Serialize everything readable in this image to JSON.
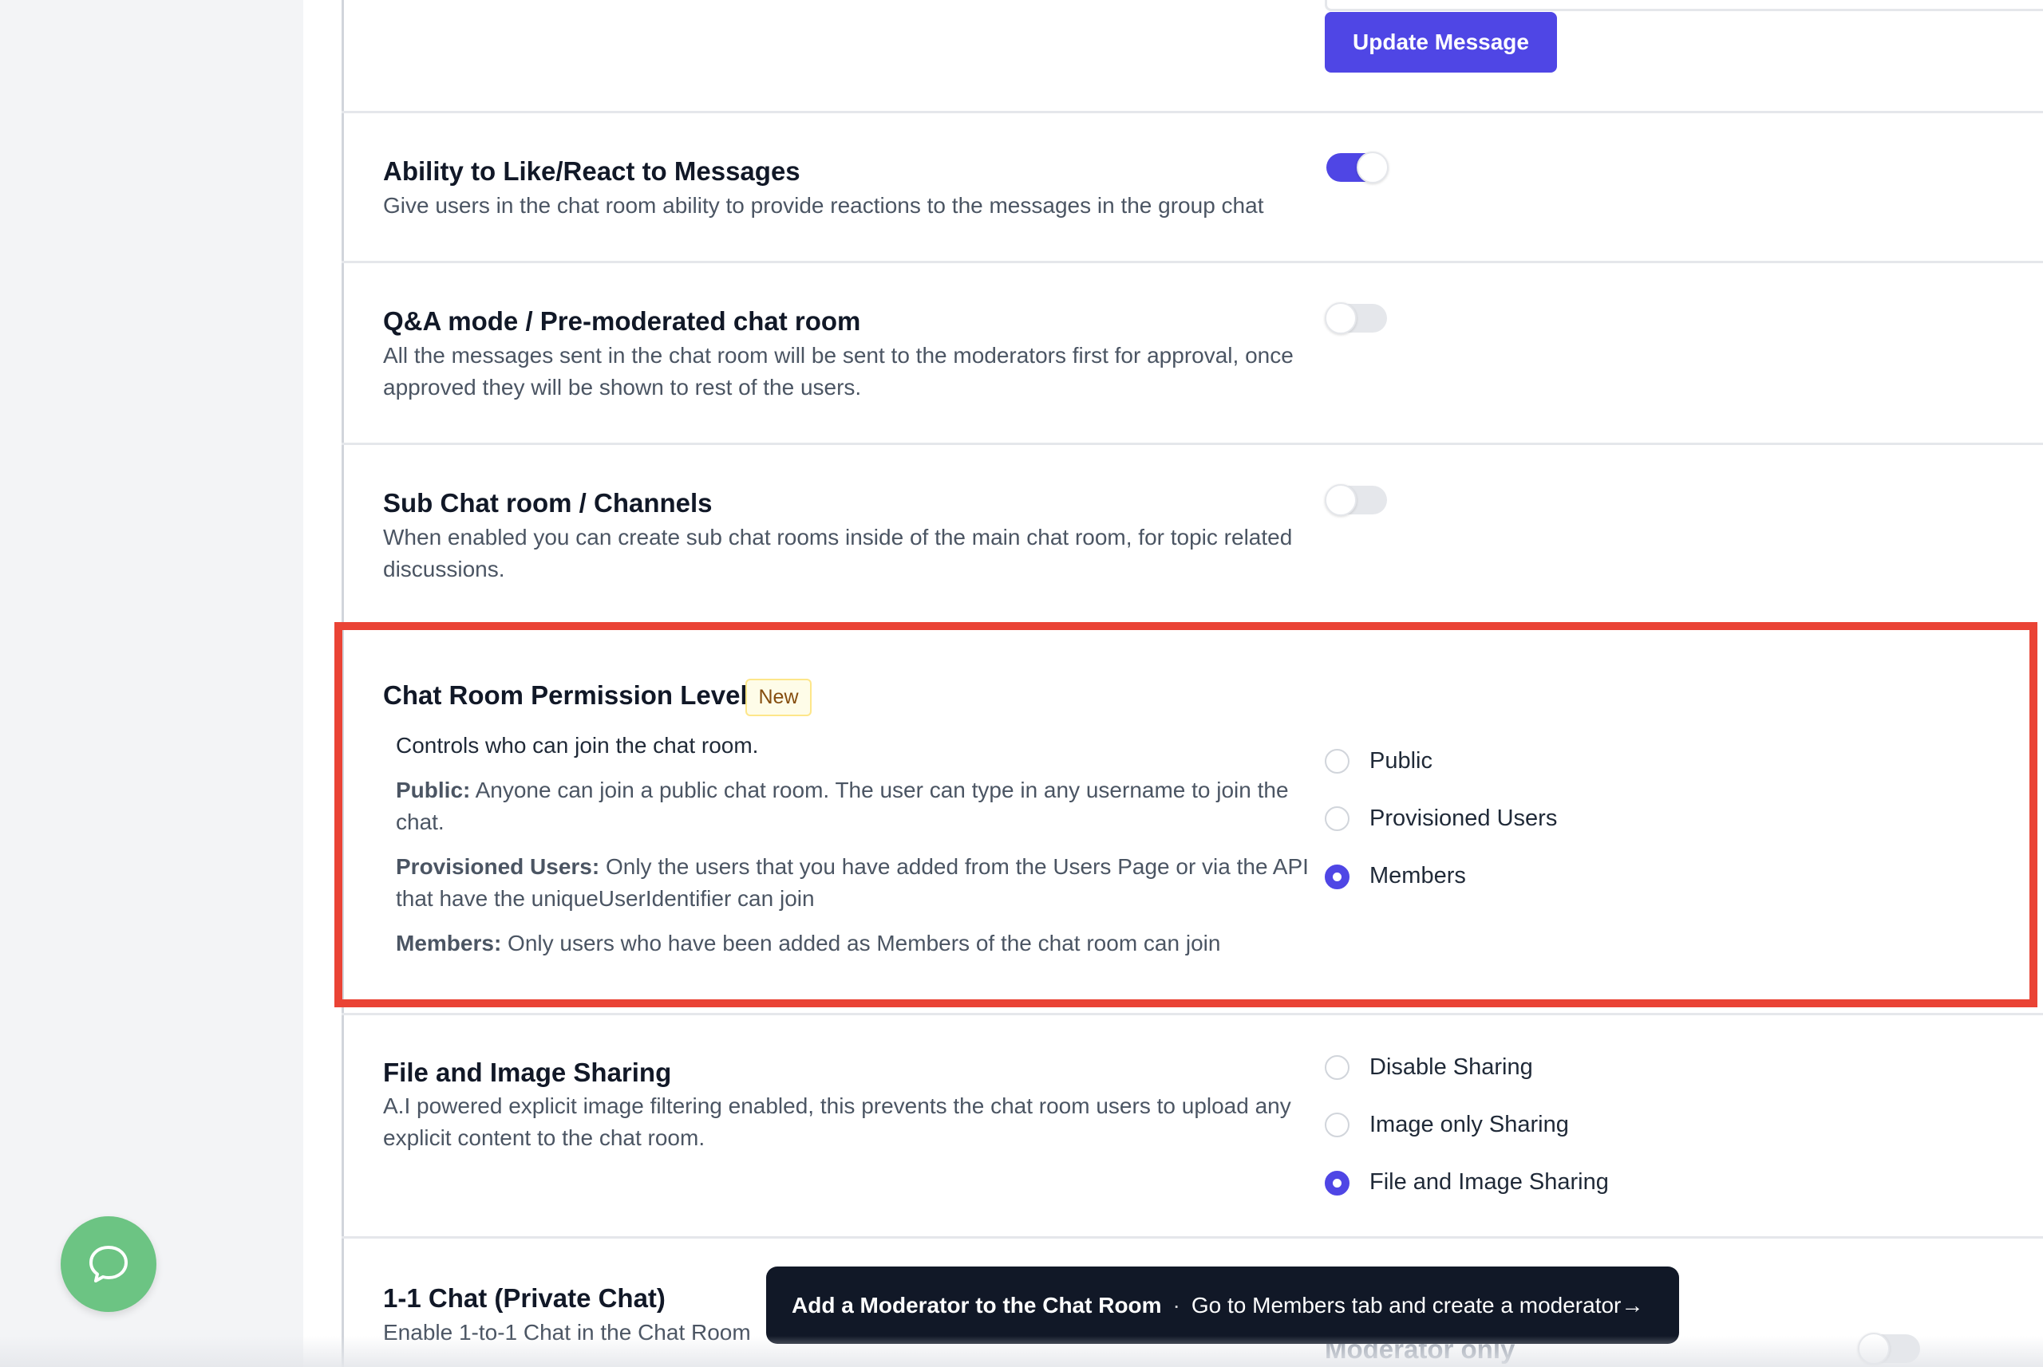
{
  "top_section": {
    "update_button_label": "Update Message"
  },
  "settings": {
    "like_react": {
      "title": "Ability to Like/React to Messages",
      "description": "Give users in the chat room ability to provide reactions to the messages in the group chat",
      "enabled": true
    },
    "qa_mode": {
      "title": "Q&A mode / Pre-moderated chat room",
      "description": "All the messages sent in the chat room will be sent to the moderators first for approval, once approved they will be shown to rest of the users.",
      "enabled": false
    },
    "sub_chat": {
      "title": "Sub Chat room / Channels",
      "description": "When enabled you can create sub chat rooms inside of the main chat room, for topic related discussions.",
      "enabled": false
    },
    "permission_level": {
      "title": "Chat Room Permission Level",
      "badge": "New",
      "intro": "Controls who can join the chat room.",
      "public_label": "Public:",
      "public_desc": "Anyone can join a public chat room. The user can type in any username to join the chat.",
      "provisioned_label": "Provisioned Users:",
      "provisioned_desc": "Only the users that you have added from the Users Page or via the API that have the uniqueUserIdentifier can join",
      "members_label": "Members:",
      "members_desc": "Only users who have been added as Members of the chat room can join",
      "options": [
        "Public",
        "Provisioned Users",
        "Members"
      ],
      "selected": "Members"
    },
    "file_sharing": {
      "title": "File and Image Sharing",
      "description": "A.I powered explicit image filtering enabled, this prevents the chat room users to upload any explicit content to the chat room.",
      "options": [
        "Disable Sharing",
        "Image only Sharing",
        "File and Image Sharing"
      ],
      "selected": "File and Image Sharing"
    },
    "private_chat": {
      "title": "1-1 Chat (Private Chat)",
      "description": "Enable 1-to-1 Chat in the Chat Room",
      "enabled": false
    }
  },
  "toast": {
    "title": "Add a Moderator to the Chat Room",
    "separator": "·",
    "message": "Go to Members tab and create a moderator→"
  },
  "moderator_only_label": "Moderator only",
  "colors": {
    "accent": "#4f46e5",
    "highlight": "#ea4335",
    "chat_bubble": "#6cc483"
  },
  "icons": {
    "chat_bubble": "chat-bubble-icon"
  }
}
